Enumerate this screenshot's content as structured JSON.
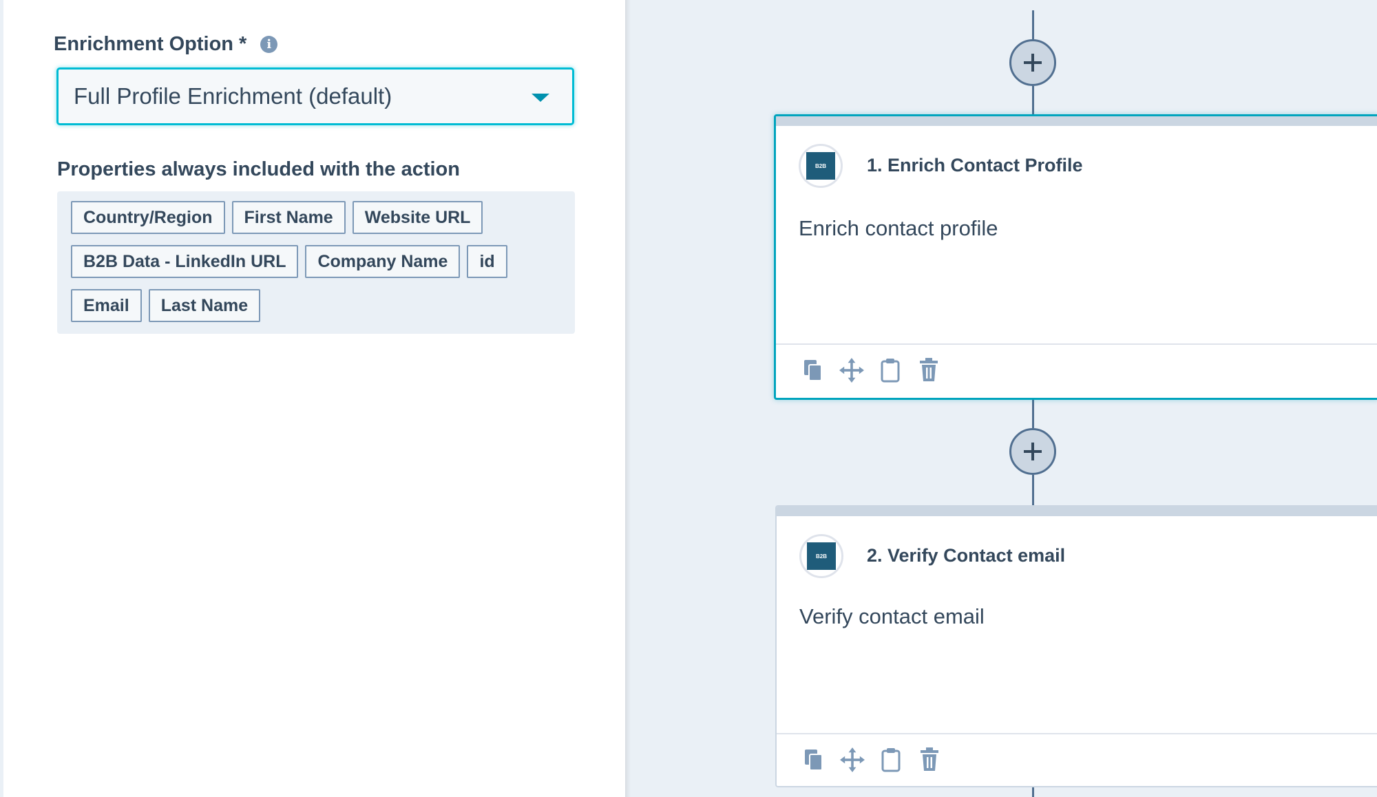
{
  "left_panel": {
    "field_label": "Enrichment Option *",
    "select_value": "Full Profile Enrichment (default)",
    "props_label": "Properties always included with the action",
    "tags": [
      [
        "Country/Region",
        "First Name",
        "Website URL"
      ],
      [
        "B2B Data - LinkedIn URL",
        "Company Name",
        "id"
      ],
      [
        "Email",
        "Last Name"
      ]
    ]
  },
  "workflow": {
    "actions": [
      {
        "title": "1. Enrich Contact Profile",
        "description": "Enrich contact profile",
        "logo_text": "B2B"
      },
      {
        "title": "2. Verify Contact email",
        "description": "Verify contact email",
        "logo_text": "B2B"
      }
    ],
    "action_icons": [
      "copy-icon",
      "move-icon",
      "clipboard-icon",
      "trash-icon"
    ]
  },
  "colors": {
    "accent": "#00a4bd",
    "text": "#33475b",
    "canvas_bg": "#eaf0f6",
    "connector": "#516f90"
  }
}
